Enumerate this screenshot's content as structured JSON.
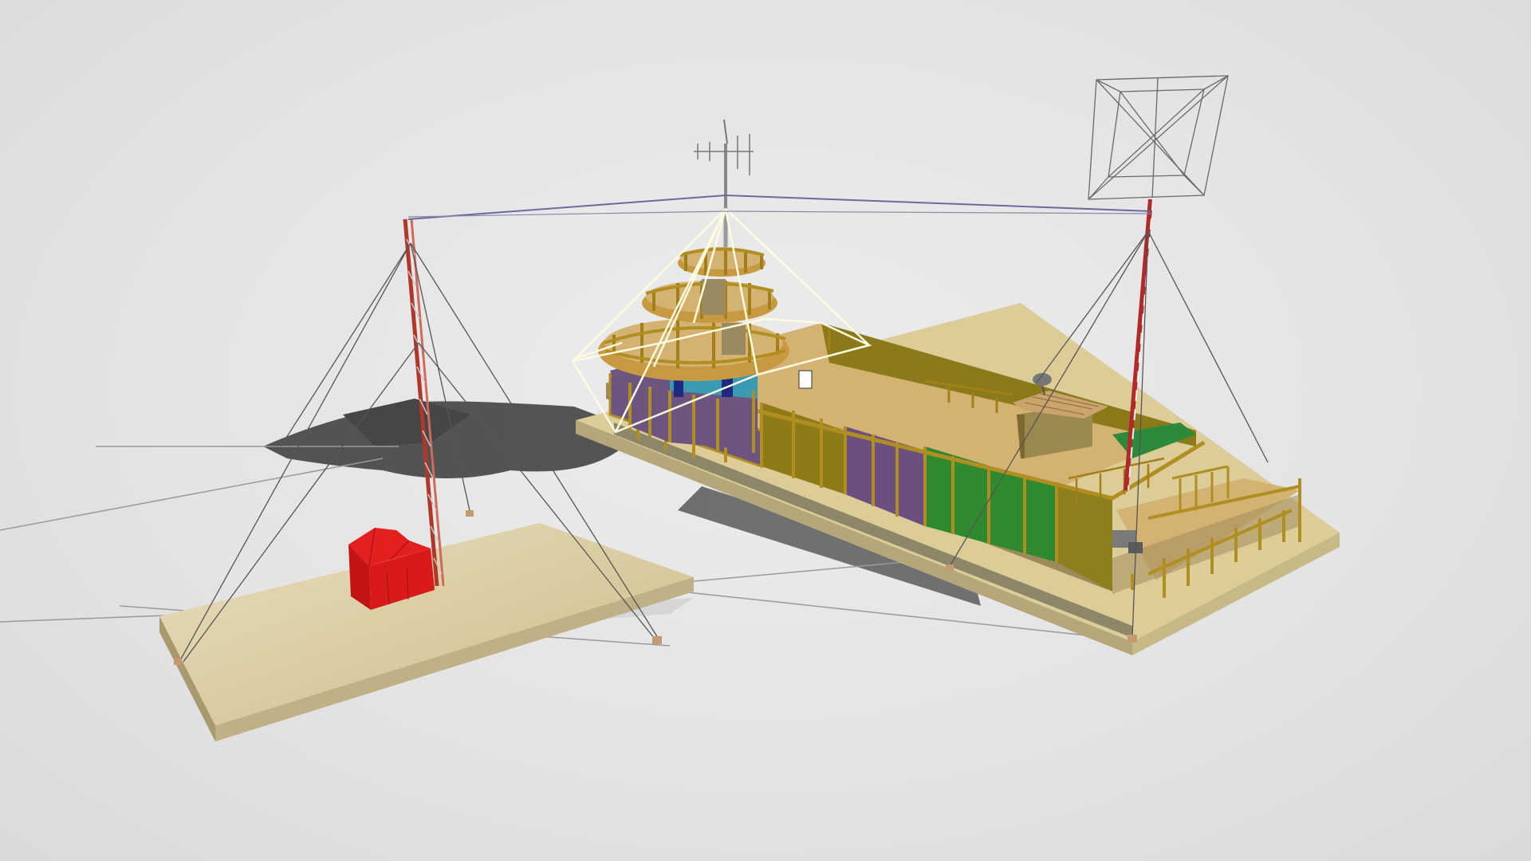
{
  "scene": {
    "background_color": "#e4e4e4",
    "platform_color": "#ddcd98",
    "platform_edge_color": "#b9ab7d",
    "deck_color": "#d9b779",
    "wood_color": "#a27f1a",
    "wall_purple": "#6b4f7a",
    "wall_green": "#2e8b2e",
    "wall_olive": "#8b7a1a",
    "tent_color": "#d41818",
    "mast_color": "#b03a2e",
    "guy_wire_color": "#555555",
    "antenna_wire_color": "#6a6aa0",
    "cage_line_color": "#fffbe0"
  }
}
